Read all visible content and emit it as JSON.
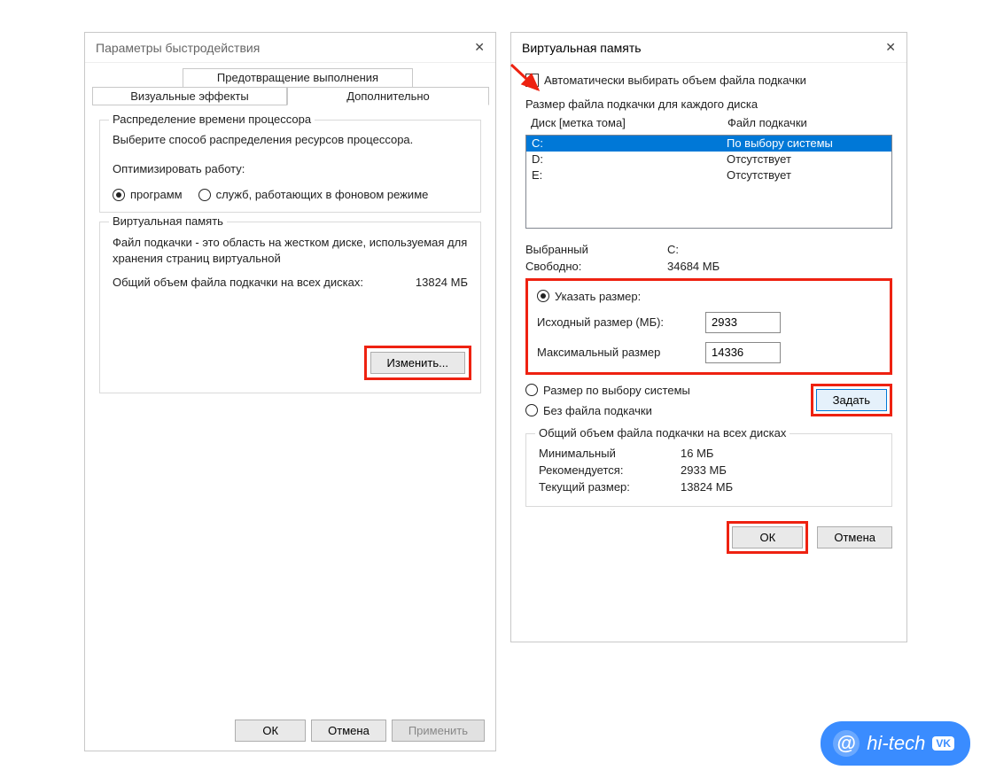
{
  "perf": {
    "title": "Параметры быстродействия",
    "tabs": {
      "dep": "Предотвращение выполнения данных",
      "visual": "Визуальные эффекты",
      "advanced": "Дополнительно"
    },
    "cpu": {
      "legend": "Распределение времени процессора",
      "desc": "Выберите способ распределения ресурсов процессора.",
      "optimize_label": "Оптимизировать работу:",
      "radio_programs": "программ",
      "radio_services": "служб, работающих в фоновом режиме"
    },
    "vm": {
      "legend": "Виртуальная память",
      "desc1": "Файл подкачки - это область на жестком диске, используемая для хранения страниц виртуальной",
      "total_label": "Общий объем файла подкачки на всех дисках:",
      "total_value": "13824 МБ",
      "change_btn": "Изменить..."
    },
    "buttons": {
      "ok": "ОК",
      "cancel": "Отмена",
      "apply": "Применить"
    }
  },
  "vmem": {
    "title": "Виртуальная память",
    "auto_chk": "Автоматически выбирать объем файла подкачки",
    "per_drive_label": "Размер файла подкачки для каждого диска",
    "col_drive": "Диск [метка тома]",
    "col_file": "Файл подкачки",
    "rows": [
      {
        "drive": "C:",
        "file": "По выбору системы",
        "selected": true
      },
      {
        "drive": "D:",
        "file": "Отсутствует",
        "selected": false
      },
      {
        "drive": "E:",
        "file": "Отсутствует",
        "selected": false
      }
    ],
    "selected_label": "Выбранный",
    "selected_value": "C:",
    "free_label": "Свободно:",
    "free_value": "34684 МБ",
    "custom": {
      "radio": "Указать размер:",
      "initial_label": "Исходный размер (МБ):",
      "initial_value": "2933",
      "max_label": "Максимальный размер",
      "max_value": "14336"
    },
    "radio_system": "Размер по выбору системы",
    "radio_none": "Без файла подкачки",
    "set_btn": "Задать",
    "totals": {
      "legend": "Общий объем файла подкачки на всех дисках",
      "min_label": "Минимальный",
      "min_value": "16 МБ",
      "rec_label": "Рекомендуется:",
      "rec_value": "2933 МБ",
      "cur_label": "Текущий размер:",
      "cur_value": "13824 МБ"
    },
    "buttons": {
      "ok": "ОК",
      "cancel": "Отмена"
    }
  },
  "watermark": "hi-tech"
}
